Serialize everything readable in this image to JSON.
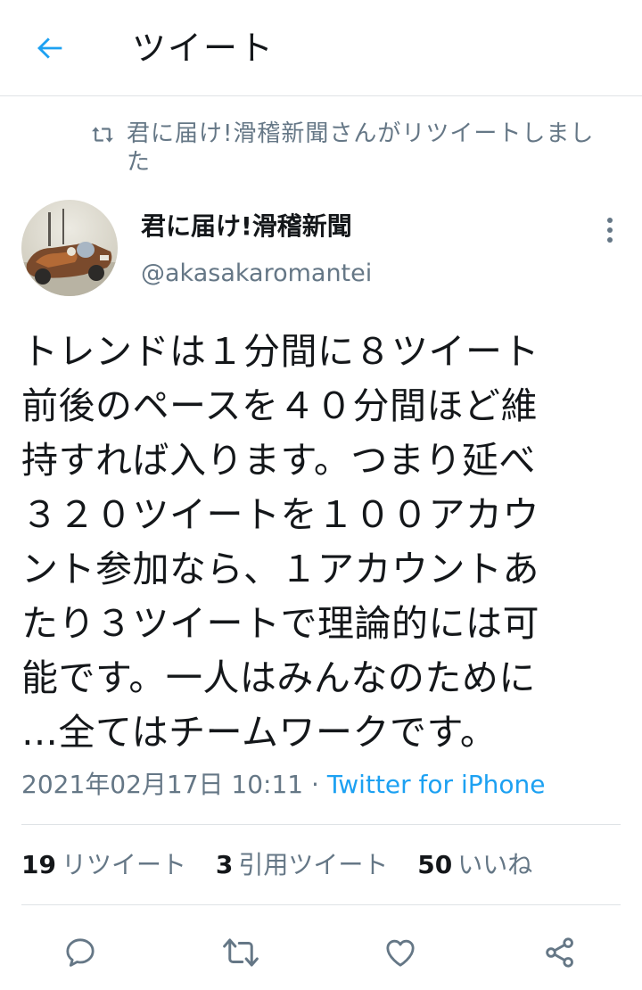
{
  "header": {
    "back_icon": "arrow-left-icon",
    "title": "ツイート"
  },
  "retweet_context": {
    "icon": "retweet-icon",
    "text": "君に届け!滑稽新聞さんがリツイートしました"
  },
  "author": {
    "avatar": "avatar-photo",
    "name": "君に届け!滑稽新聞",
    "handle": "@akasakaromantei",
    "more_icon": "more-vertical-icon"
  },
  "tweet": {
    "text": "トレンドは１分間に８ツイート\n前後のペースを４０分間ほど維\n持すれば入ります。つまり延べ\n３２０ツイートを１００アカウ\nント参加なら、１アカウントあ\nたり３ツイートで理論的には可\n能です。一人はみんなのために\n…全てはチームワークです。",
    "timestamp": "2021年02月17日 10:11",
    "separator": " · ",
    "source": "Twitter for iPhone"
  },
  "stats": {
    "retweets_count": "19",
    "retweets_label": "リツイート",
    "quotes_count": "3",
    "quotes_label": "引用ツイート",
    "likes_count": "50",
    "likes_label": "いいね"
  },
  "actions": {
    "reply_icon": "reply-icon",
    "retweet_icon": "retweet-icon",
    "like_icon": "heart-icon",
    "share_icon": "share-icon"
  },
  "colors": {
    "accent": "#1da1f2",
    "secondary_text": "#657786",
    "primary_text": "#14171a"
  }
}
